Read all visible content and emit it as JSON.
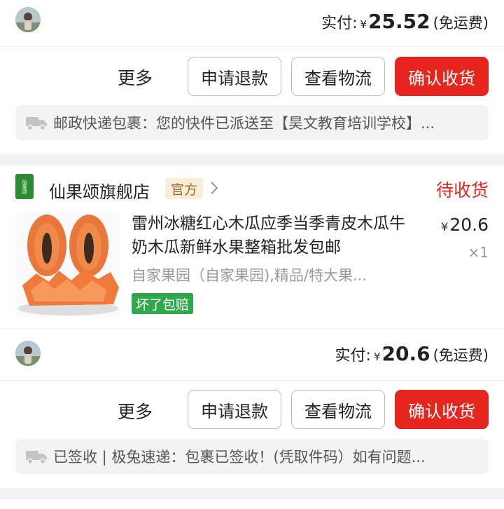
{
  "order1": {
    "pay_label": "实付:",
    "currency": "¥",
    "amount": "25.52",
    "shipping": "(免运费)",
    "more_label": "更多",
    "refund_label": "申请退款",
    "logistics_label": "查看物流",
    "confirm_label": "确认收货",
    "tracking_text": "邮政快递包裹：您的快件已派送至【昊文教育培训学校】..."
  },
  "order2": {
    "store_logo_text": "仙果颂",
    "store_name": "仙果颂旗舰店",
    "official_badge": "官方",
    "status": "待收货",
    "product_title": "雷州冰糖红心木瓜应季当季青皮木瓜牛奶木瓜新鲜水果整箱批发包邮",
    "product_sku": "自家果园（自家果园),精品/特大果...",
    "product_tag": "坏了包赔",
    "currency": "¥",
    "price": "20.6",
    "quantity": "×1",
    "pay_label": "实付:",
    "amount": "20.6",
    "shipping": "(免运费)",
    "more_label": "更多",
    "refund_label": "申请退款",
    "logistics_label": "查看物流",
    "confirm_label": "确认收货",
    "tracking_text": "已签收 | 极兔速递：包裹已签收！(凭取件码）如有问题..."
  },
  "colors": {
    "accent_red": "#e6251e",
    "tag_green": "#2ea84a",
    "official_bg": "#fbecd8"
  },
  "icons": [
    "avatar",
    "truck-icon",
    "chevron-right-icon",
    "store-logo"
  ]
}
